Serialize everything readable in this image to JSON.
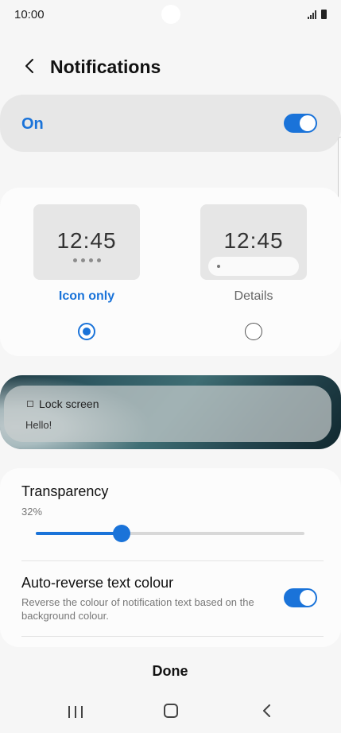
{
  "status_bar": {
    "time": "10:00"
  },
  "header": {
    "title": "Notifications"
  },
  "master": {
    "label": "On",
    "enabled": true
  },
  "style_options": [
    {
      "clock": "12:45",
      "label": "Icon only",
      "selected": true
    },
    {
      "clock": "12:45",
      "label": "Details",
      "selected": false
    }
  ],
  "preview": {
    "title": "Lock screen",
    "body": "Hello!"
  },
  "transparency": {
    "label": "Transparency",
    "value_text": "32%",
    "value": 0.32
  },
  "auto_reverse": {
    "label": "Auto-reverse text colour",
    "description": "Reverse the colour of notification text based on the background colour.",
    "enabled": true
  },
  "footer": {
    "done_label": "Done"
  },
  "colors": {
    "accent": "#1a73d9",
    "background": "#f6f6f6",
    "card": "#fcfcfc"
  },
  "icons": {
    "back": "chevron-left-icon",
    "signal": "signal-icon",
    "battery": "battery-icon",
    "nav_recents": "recents-icon",
    "nav_home": "home-icon",
    "nav_back": "back-icon"
  }
}
